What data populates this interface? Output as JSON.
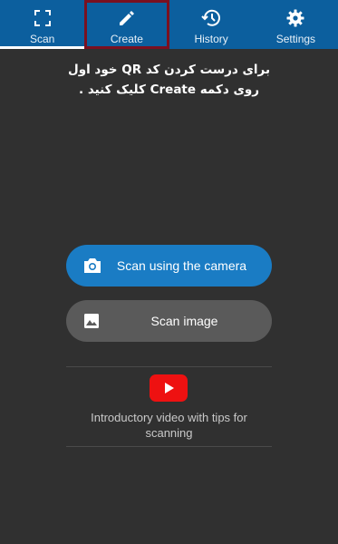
{
  "tabs": [
    {
      "label": "Scan",
      "icon": "scan-icon"
    },
    {
      "label": "Create",
      "icon": "pencil-icon"
    },
    {
      "label": "History",
      "icon": "history-icon"
    },
    {
      "label": "Settings",
      "icon": "gear-icon"
    }
  ],
  "instructions": {
    "line1": "برای درست کردن کد QR خود اول",
    "line2": "روی دکمه Create  کلیک کنید ."
  },
  "buttons": {
    "camera_label": "Scan using the camera",
    "image_label": "Scan image"
  },
  "video": {
    "label": "Introductory video with tips for scanning",
    "icon": "youtube-icon"
  },
  "colors": {
    "tabbar": "#0c5f9e",
    "background": "#303030",
    "camera_button": "#1a7cc4",
    "image_button": "#5a5a5a",
    "highlight_outline": "#7a1020"
  }
}
